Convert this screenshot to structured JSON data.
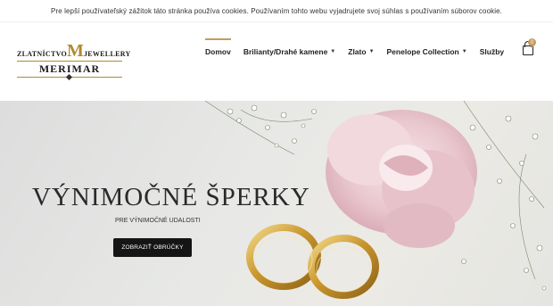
{
  "cookie_bar": {
    "text": "Pre lepší používateľský zážitok táto stránka používa cookies. Používaním tohto webu vyjadrujete svoj súhlas s používaním súborov cookie."
  },
  "logo": {
    "left_text": "ZLATNÍCTVO",
    "monogram": "M",
    "right_text": "JEWELLERY",
    "name": "MERIMAR"
  },
  "nav": {
    "items": [
      {
        "label": "Domov",
        "active": true,
        "dropdown": false
      },
      {
        "label": "Brilianty/Drahé kamene",
        "active": false,
        "dropdown": true
      },
      {
        "label": "Zlato",
        "active": false,
        "dropdown": true
      },
      {
        "label": "Penelope Collection",
        "active": false,
        "dropdown": true
      },
      {
        "label": "Služby",
        "active": false,
        "dropdown": false
      }
    ]
  },
  "cart": {
    "count": "0"
  },
  "hero": {
    "title": "VÝNIMOČNÉ ŠPERKY",
    "subtitle": "PRE VÝNIMOČNÉ UDALOSTI",
    "button_label": "ZOBRAZIŤ OBRÚČKY"
  },
  "colors": {
    "accent": "#c59b5f",
    "logo_gold": "#b08a2e",
    "button_bg": "#151515"
  }
}
